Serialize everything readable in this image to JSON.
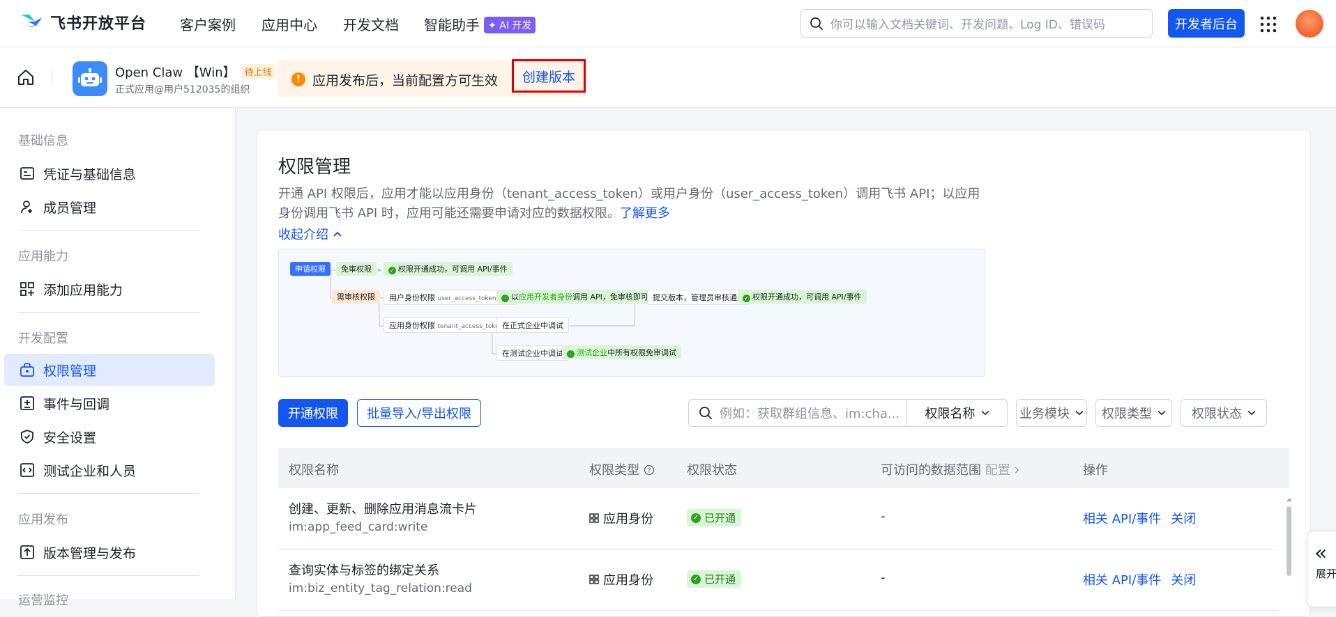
{
  "brand": {
    "name": "飞书开放平台"
  },
  "nav": {
    "items": [
      "客户案例",
      "应用中心",
      "开发文档",
      "智能助手"
    ],
    "ai_badge": "AI 开发"
  },
  "search": {
    "placeholder": "你可以输入文档关键词、开发问题、Log ID、错误码"
  },
  "console_button": "开发者后台",
  "app": {
    "name": "Open Claw 【Win】",
    "status_badge": "待上线",
    "org": "正式应用@用户512035的组织"
  },
  "notice": {
    "text": "应用发布后，当前配置方可生效",
    "action": "创建版本"
  },
  "sidebar": {
    "groups": [
      {
        "title": "基础信息",
        "items": [
          {
            "label": "凭证与基础信息",
            "icon": "credential-icon"
          },
          {
            "label": "成员管理",
            "icon": "member-icon"
          }
        ]
      },
      {
        "title": "应用能力",
        "items": [
          {
            "label": "添加应用能力",
            "icon": "grid-add-icon"
          }
        ]
      },
      {
        "title": "开发配置",
        "items": [
          {
            "label": "权限管理",
            "icon": "permission-icon",
            "active": true
          },
          {
            "label": "事件与回调",
            "icon": "event-icon"
          },
          {
            "label": "安全设置",
            "icon": "shield-icon"
          },
          {
            "label": "测试企业和人员",
            "icon": "code-icon"
          }
        ]
      },
      {
        "title": "应用发布",
        "items": [
          {
            "label": "版本管理与发布",
            "icon": "upload-icon"
          }
        ]
      },
      {
        "title": "运营监控",
        "items": []
      }
    ]
  },
  "main": {
    "title": "权限管理",
    "intro": "开通 API 权限后，应用才能以应用身份（tenant_access_token）或用户身份（user_access_token）调用飞书 API；以应用身份调用飞书 API 时，应用可能还需要申请对应的数据权限。",
    "learn_more": "了解更多",
    "collapse": "收起介绍",
    "flow": {
      "apply": "申请权限",
      "no_review": "免审权限",
      "success1": "权限开通成功，可调用 API/事件",
      "need_review": "需审核权限",
      "user_identity": "用户身份权限",
      "user_identity_sub": "user_access_token 调用",
      "dev_identity_pre": "以",
      "dev_identity_hl": "应用开发者身份",
      "dev_identity_post": "调用 API，免审核即可调试",
      "submit": "提交版本，管理员审核通过",
      "success2": "权限开通成功，可调用 API/事件",
      "app_identity": "应用身份权限",
      "app_identity_sub": "tenant_access_token 调用",
      "prod_debug": "在正式企业中调试",
      "test_debug": "在测试企业中调试",
      "test_free_hl": "测试企业",
      "test_free_post": "中所有权限免审调试"
    },
    "buttons": {
      "open": "开通权限",
      "batch": "批量导入/导出权限"
    },
    "filter": {
      "placeholder": "例如：获取群组信息、im:cha...",
      "field": "权限名称",
      "module": "业务模块",
      "type": "权限类型",
      "status": "权限状态"
    },
    "table": {
      "headers": {
        "name": "权限名称",
        "type": "权限类型",
        "status": "权限状态",
        "range": "可访问的数据范围",
        "range_link": "配置",
        "ops": "操作"
      },
      "rows": [
        {
          "name": "创建、更新、删除应用消息流卡片",
          "code": "im:app_feed_card:write",
          "type": "应用身份",
          "status": "已开通",
          "range": "-",
          "op1": "相关 API/事件",
          "op2": "关闭"
        },
        {
          "name": "查询实体与标签的绑定关系",
          "code": "im:biz_entity_tag_relation:read",
          "type": "应用身份",
          "status": "已开通",
          "range": "-",
          "op1": "相关 API/事件",
          "op2": "关闭"
        }
      ]
    }
  },
  "expand_tab": {
    "label": "展开"
  },
  "colors": {
    "primary": "#1456f0",
    "highlight_border": "#e00000",
    "success": "#2ea121",
    "warning": "#ff8800"
  }
}
